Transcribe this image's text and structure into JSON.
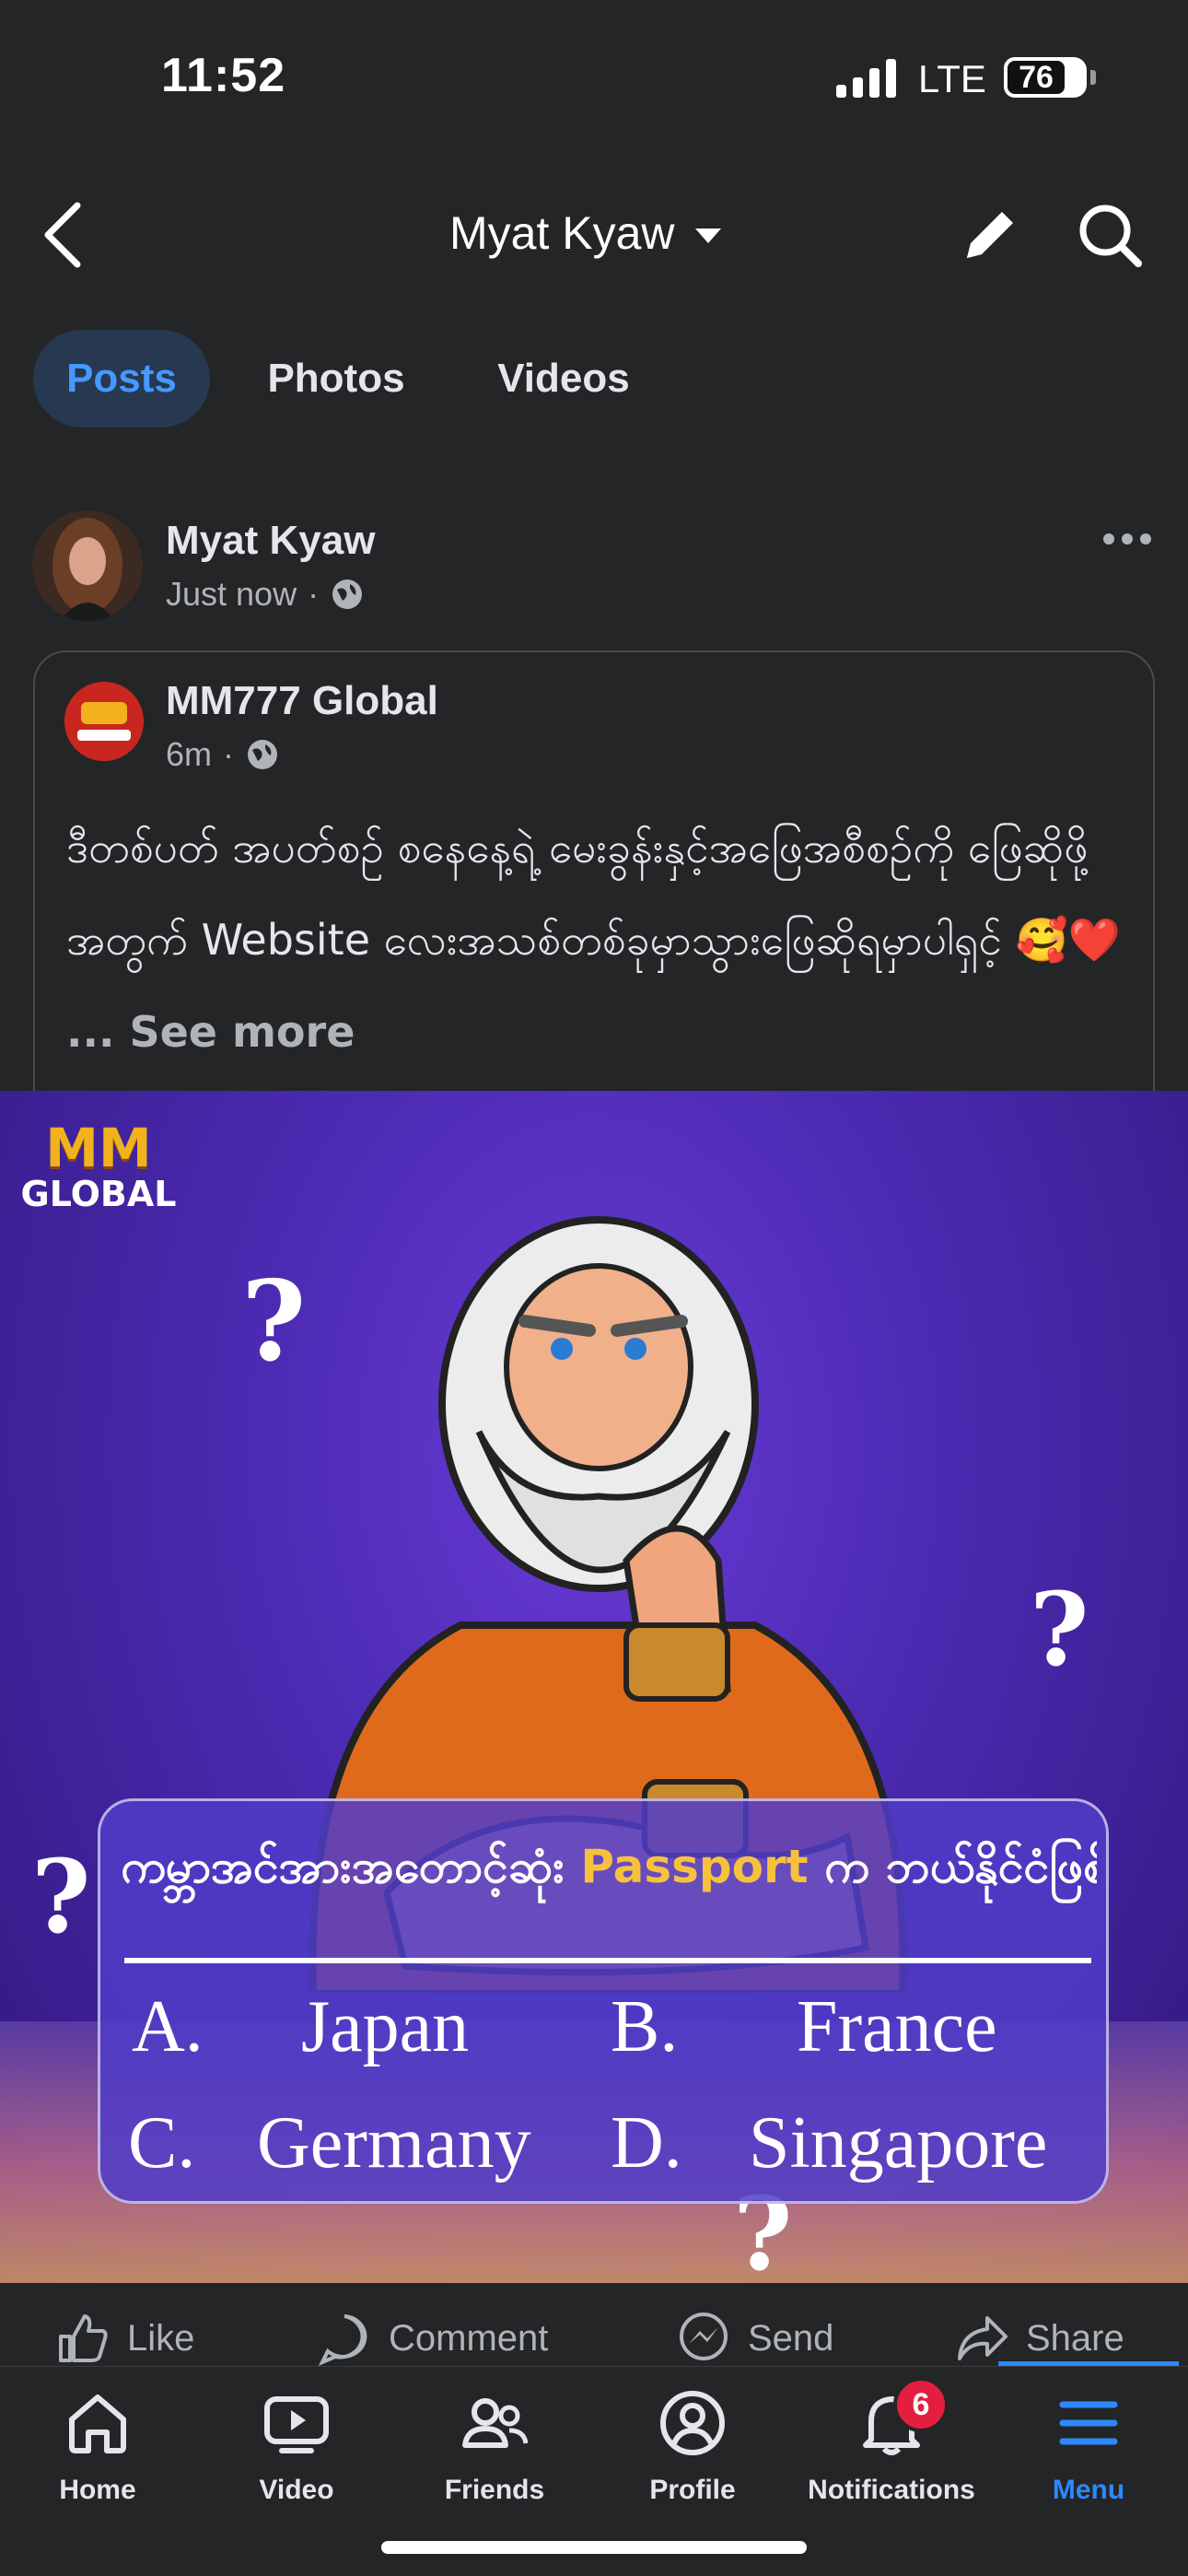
{
  "status_bar": {
    "time": "11:52",
    "network": "LTE",
    "battery": "76"
  },
  "header": {
    "title": "Myat Kyaw"
  },
  "tabs": [
    {
      "label": "Posts",
      "active": true
    },
    {
      "label": "Photos",
      "active": false
    },
    {
      "label": "Videos",
      "active": false
    }
  ],
  "post": {
    "author": "Myat Kyaw",
    "time": "Just now",
    "shared": {
      "page_name": "MM777 Global",
      "time": "6m",
      "caption": "ဒီတစ်ပတ် အပတ်စဉ် စနေနေ့ရဲ့ မေးခွန်းနှင့်အဖြေအစီစဉ်ကို ဖြေဆိုဖို့အတွက် Website လေးအသစ်တစ်ခုမှာသွားဖြေဆိုရမှာပါရှင့် 🥰❤️",
      "see_more": "... See more"
    },
    "image": {
      "brand_top": "MM",
      "brand_bottom": "GLOBAL",
      "question_pre": "ကမ္ဘာအင်အားအတောင့်ဆုံး",
      "question_highlight": "Passport",
      "question_post": "က ဘယ်နိုင်ငံဖြစ်မလည်း ?",
      "options": [
        {
          "letter": "A.",
          "text": "Japan"
        },
        {
          "letter": "B.",
          "text": "France"
        },
        {
          "letter": "C.",
          "text": "Germany"
        },
        {
          "letter": "D.",
          "text": "Singapore"
        }
      ],
      "qmark": "?"
    }
  },
  "actions": {
    "like": "Like",
    "comment": "Comment",
    "send": "Send",
    "share": "Share"
  },
  "nav": {
    "home": "Home",
    "video": "Video",
    "friends": "Friends",
    "profile": "Profile",
    "notifications": "Notifications",
    "notifications_badge": "6",
    "menu": "Menu"
  },
  "colors": {
    "accent": "#2d88ff",
    "background": "#242526",
    "badge": "#e41e3f"
  }
}
